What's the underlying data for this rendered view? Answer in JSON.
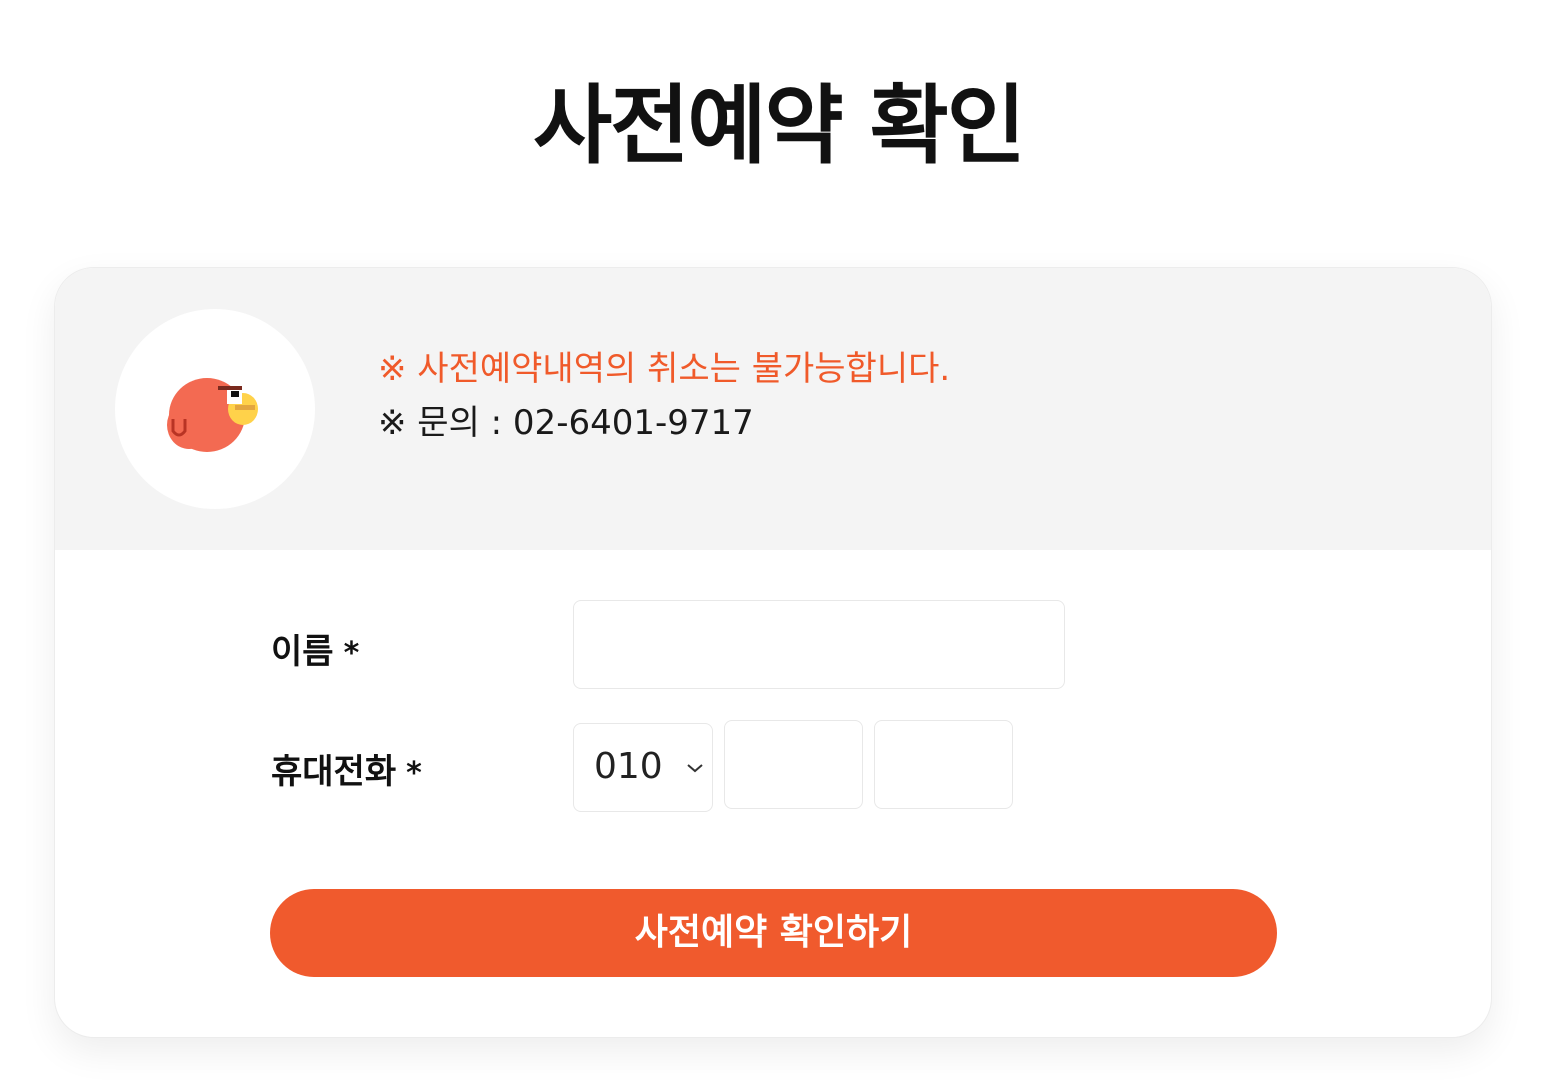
{
  "page": {
    "title": "사전예약 확인"
  },
  "notice": {
    "warning": "※ 사전예약내역의 취소는 불가능합니다.",
    "contact": "※ 문의 : 02-6401-9717",
    "warning_color": "#f05a2a"
  },
  "form": {
    "name_label": "이름",
    "phone_label": "휴대전화",
    "required_mark": "*",
    "name_value": "",
    "phone_prefix": "010",
    "phone_middle": "",
    "phone_last": ""
  },
  "submit": {
    "label": "사전예약 확인하기",
    "color": "#f05a2d"
  }
}
